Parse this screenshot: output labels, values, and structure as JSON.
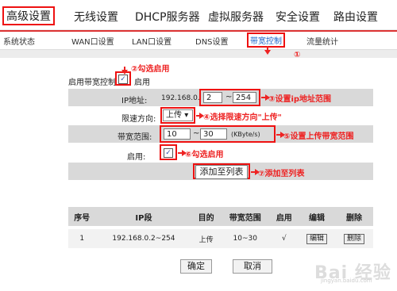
{
  "top_nav": [
    "高级设置",
    "无线设置",
    "DHCP服务器",
    "虚拟服务器",
    "安全设置",
    "路由设置"
  ],
  "sub_nav": [
    "系统状态",
    "WAN口设置",
    "LAN口设置",
    "DNS设置",
    "带宽控制",
    "流量统计"
  ],
  "annotations": {
    "a1": "①",
    "a2": "②勾选启用",
    "a3": "③设置ip地址范围",
    "a4": "④选择限速方向\"上传\"",
    "a5": "⑤设置上传带宽范围",
    "a6": "⑥勾选启用",
    "a7": "⑦添加至列表"
  },
  "form": {
    "enable_bw_label": "启用带宽控制",
    "enable_label": "启用",
    "check_mark": "✓",
    "ip_label": "IP地址:",
    "ip_prefix": "192.168.0.",
    "ip_start": "2",
    "ip_sep": "~",
    "ip_end": "254",
    "dir_label": "限速方向:",
    "dir_value": "上传",
    "dir_caret": "▾",
    "bw_label": "带宽范围:",
    "bw_min": "10",
    "bw_sep": "~",
    "bw_max": "30",
    "bw_unit": "(KByte/s)",
    "row_enable_label": "启用:",
    "add_button": "添加至列表"
  },
  "table": {
    "headers": [
      "序号",
      "IP段",
      "目的",
      "带宽范围",
      "启用",
      "编辑",
      "删除"
    ],
    "rows": [
      [
        "1",
        "192.168.0.2~254",
        "上传",
        "10~30",
        "√",
        "编辑",
        "删除"
      ]
    ]
  },
  "footer": {
    "ok": "确定",
    "cancel": "取消"
  },
  "watermark": {
    "main": "Bai 经验",
    "sub": "jingyan.baidu.com"
  }
}
